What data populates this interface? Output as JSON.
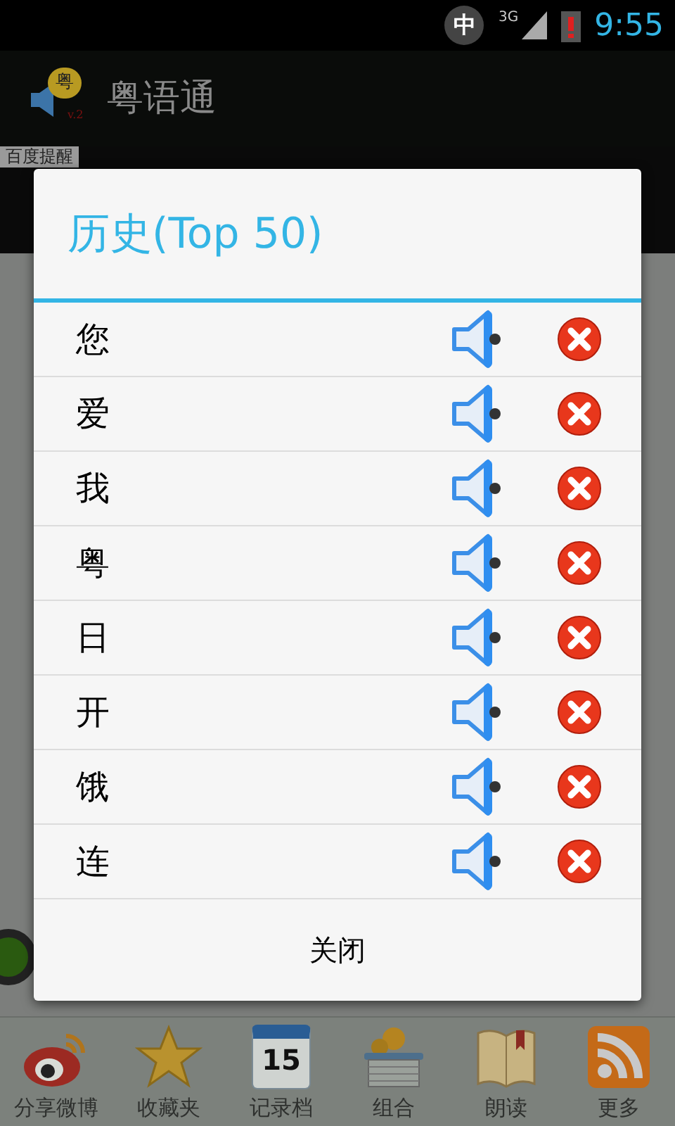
{
  "status_bar": {
    "ime": "中",
    "network": "3G",
    "time": "9:55"
  },
  "header": {
    "logo_badge": "粤",
    "logo_version": "v.2",
    "title": "粤语通"
  },
  "notice_tab": "百度提醒",
  "dialog": {
    "title": "历史(Top 50)",
    "rows": [
      {
        "word": "您"
      },
      {
        "word": "爱"
      },
      {
        "word": "我"
      },
      {
        "word": "粤"
      },
      {
        "word": "日"
      },
      {
        "word": "开"
      },
      {
        "word": "饿"
      },
      {
        "word": "连"
      }
    ],
    "close_button": "关闭"
  },
  "toolbar": [
    {
      "kind": "weibo",
      "label": "分享微博"
    },
    {
      "kind": "star",
      "label": "收藏夹"
    },
    {
      "kind": "calendar",
      "label": "记录档",
      "number": "15"
    },
    {
      "kind": "basket",
      "label": "组合"
    },
    {
      "kind": "book",
      "label": "朗读"
    },
    {
      "kind": "rss",
      "label": "更多"
    }
  ]
}
